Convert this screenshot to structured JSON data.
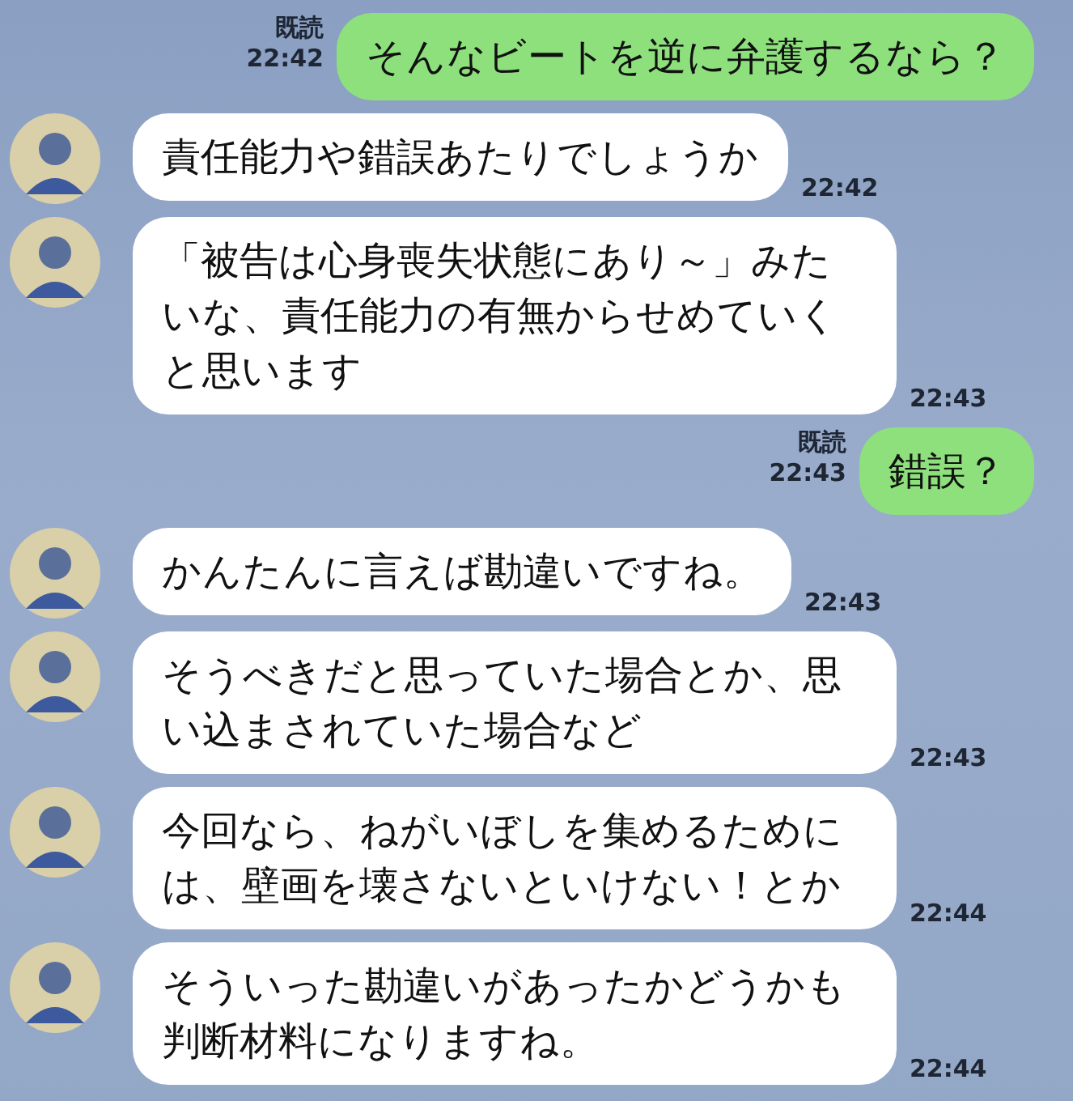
{
  "messages": [
    {
      "kind": "outgoing",
      "text": "そんなビートを逆に弁護するなら？",
      "read_label": "既読",
      "time": "22:42"
    },
    {
      "kind": "incoming",
      "text": "責任能力や錯誤あたりでしょうか",
      "time": "22:42"
    },
    {
      "kind": "incoming",
      "text": "「被告は心身喪失状態にあり～」みたいな、責任能力の有無からせめていくと思います",
      "time": "22:43"
    },
    {
      "kind": "outgoing",
      "text": "錯誤？",
      "read_label": "既読",
      "time": "22:43"
    },
    {
      "kind": "incoming",
      "text": "かんたんに言えば勘違いですね。",
      "time": "22:43"
    },
    {
      "kind": "incoming",
      "text": "そうべきだと思っていた場合とか、思い込まされていた場合など",
      "time": "22:43"
    },
    {
      "kind": "incoming",
      "text": "今回なら、ねがいぼしを集めるためには、壁画を壊さないといけない！とか",
      "time": "22:44"
    },
    {
      "kind": "incoming",
      "text": "そういった勘違いがあったかどうかも判断材料になりますね。",
      "time": "22:44"
    }
  ]
}
